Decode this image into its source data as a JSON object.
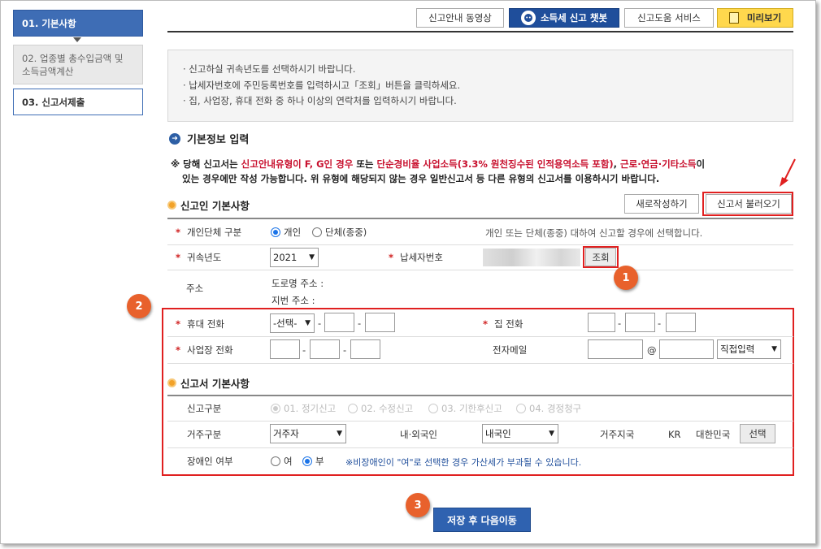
{
  "sidebar": {
    "steps": [
      {
        "label": "01. 기본사항"
      },
      {
        "label": "02. 업종별 총수입금액 및 소득금액계산"
      },
      {
        "label": "03. 신고서제출"
      }
    ]
  },
  "toolbar": {
    "video_guide": "신고안내 동영상",
    "chatbot": "소득세 신고 챗봇",
    "help_service": "신고도움 서비스",
    "preview": "미리보기"
  },
  "notice": {
    "lines": [
      "· 신고하실 귀속년도를 선택하시기 바랍니다.",
      "· 납세자번호에 주민등록번호를 입력하시고「조회」버튼을 클릭하세요.",
      "· 집, 사업장, 휴대 전화 중 하나 이상의 연락처를 입력하시기 바랍니다."
    ]
  },
  "basic_info": {
    "title": "기본정보 입력",
    "warn_prefix": "※ 당해 신고서는 ",
    "warn_red1": "신고안내유형이 F, G인 경우",
    "warn_mid1": " 또는 ",
    "warn_red2": "단순경비율 사업소득(3.3% 원천징수된 인적용역소득 포함)",
    "warn_mid2": ", ",
    "warn_red3": "근로·연금·기타소득",
    "warn_suffix": "이",
    "warn_line2": "있는 경우에만 작성 가능합니다. 위 유형에 해당되지 않는 경우 일반신고서 등 다른 유형의 신고서를 이용하시기 바랍니다."
  },
  "reporter": {
    "title": "신고인 기본사항",
    "new_button": "새로작성하기",
    "load_button": "신고서 불러오기",
    "type_label": "개인단체 구분",
    "type_individual": "개인",
    "type_group": "단체(종중)",
    "type_hint": "개인 또는 단체(종중) 대하여 신고할 경우에 선택합니다.",
    "year_label": "귀속년도",
    "year_value": "2021",
    "taxpayer_label": "납세자번호",
    "lookup_button": "조회",
    "address_label": "주소",
    "road_address": "도로명 주소 :",
    "lot_address": "지번 주소 :",
    "mobile_label": "휴대 전화",
    "mobile_select": "-선택-",
    "home_label": "집 전화",
    "work_label": "사업장 전화",
    "email_label": "전자메일",
    "email_at": "@",
    "email_domain": "직접입력",
    "dash": "-"
  },
  "report": {
    "title": "신고서 기본사항",
    "kind_label": "신고구분",
    "kinds": [
      "01. 정기신고",
      "02. 수정신고",
      "03. 기한후신고",
      "04. 경정청구"
    ],
    "residence_label": "거주구분",
    "residence_value": "거주자",
    "nationality_label": "내·외국인",
    "nationality_value": "내국인",
    "country_label": "거주지국",
    "country_code": "KR",
    "country_name": "대한민국",
    "country_select": "선택",
    "disabled_label": "장애인 여부",
    "yes": "여",
    "no": "부",
    "disabled_note": "※비장애인이 \"여\"로 선택한 경우 가산세가 부과될 수 있습니다."
  },
  "badges": [
    "1",
    "2",
    "3"
  ],
  "footer": {
    "save_next": "저장 후 다음이동"
  },
  "colors": {
    "accent": "#2f62b0",
    "highlight": "#e02020",
    "badge": "#e8612c"
  }
}
